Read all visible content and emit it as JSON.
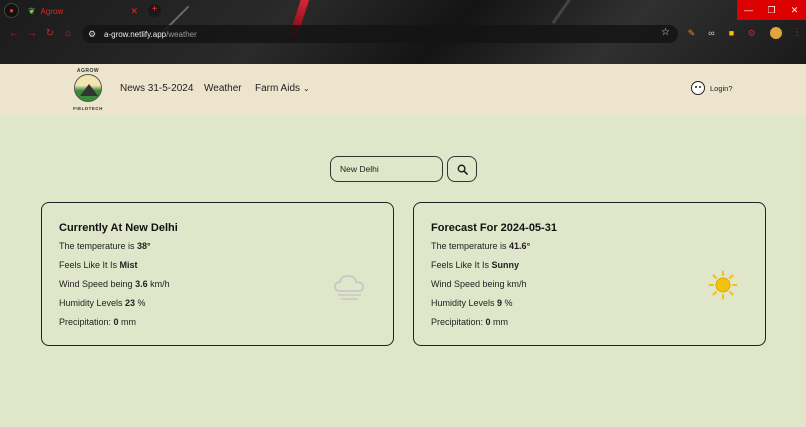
{
  "browser": {
    "tab_title": "Agrow",
    "url_host": "a-grow.netlify.app",
    "url_path": "/weather"
  },
  "header": {
    "logo_top": "AGROW",
    "logo_bottom": "FIELDTECH",
    "nav": {
      "news": "News 31-5-2024",
      "weather": "Weather",
      "farm_aids": "Farm Aids"
    },
    "login": "Login?"
  },
  "search": {
    "value": "New Delhi"
  },
  "current": {
    "title": "Currently At New Delhi",
    "temp_prefix": "The temperature is ",
    "temp": "38°",
    "feels_prefix": "Feels Like It Is ",
    "feels": "Mist",
    "wind_prefix": "Wind Speed being ",
    "wind": "3.6",
    "wind_unit": " km/h",
    "humidity_prefix": "Humidity Levels ",
    "humidity": "23",
    "humidity_unit": " %",
    "precip_prefix": "Precipitation: ",
    "precip": "0",
    "precip_unit": " mm",
    "icon": "cloud-icon"
  },
  "forecast": {
    "title": "Forecast For 2024-05-31",
    "temp_prefix": "The temperature is ",
    "temp": "41.6°",
    "feels_prefix": "Feels Like It Is ",
    "feels": "Sunny",
    "wind_text": "Wind Speed being km/h",
    "humidity_prefix": "Humidity Levels ",
    "humidity": "9",
    "humidity_unit": " %",
    "precip_prefix": "Precipitation: ",
    "precip": "0",
    "precip_unit": " mm",
    "icon": "sun-icon"
  },
  "colors": {
    "page_bg": "#dfe6c9",
    "header_bg": "#ece4cc",
    "sun": "#f4c20d"
  }
}
